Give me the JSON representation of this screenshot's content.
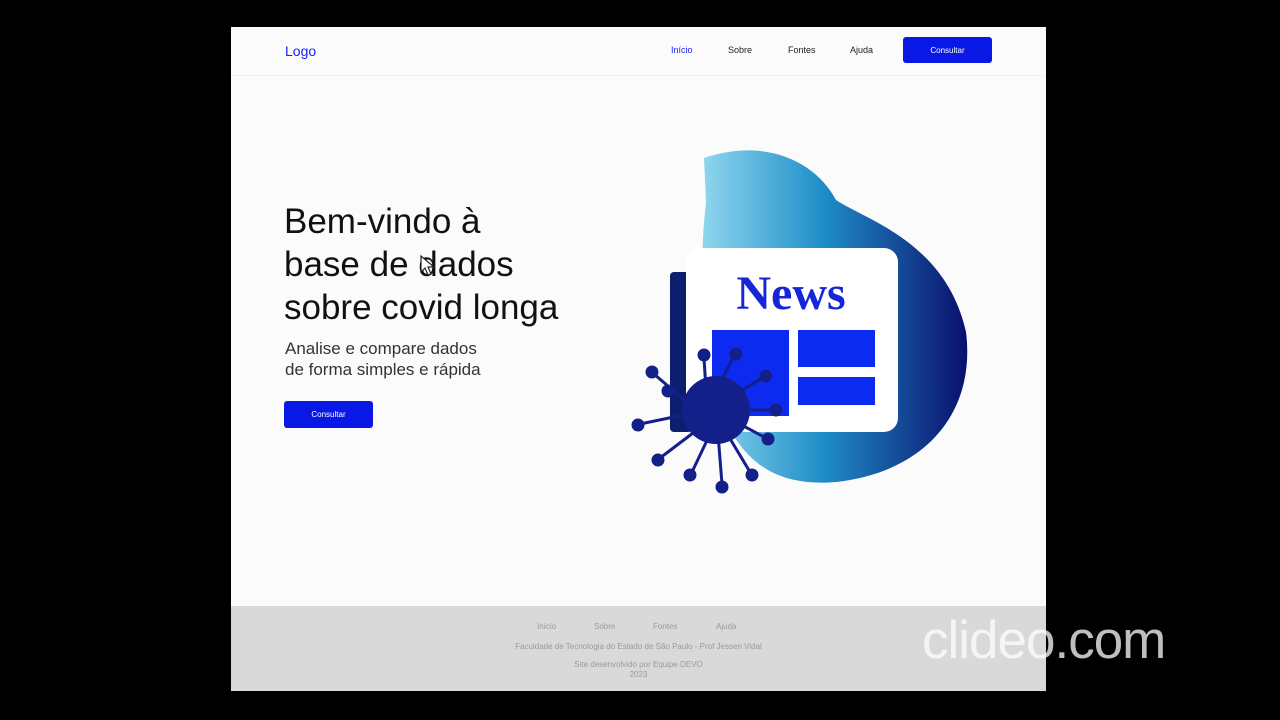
{
  "header": {
    "logo": "Logo",
    "nav": [
      "Início",
      "Sobre",
      "Fontes",
      "Ajuda"
    ],
    "cta": "Consultar"
  },
  "hero": {
    "title_lines": [
      "Bem-vindo à",
      "base de dados",
      "sobre covid longa"
    ],
    "subtitle_lines": [
      "Analise e compare dados",
      "de forma simples e rápida"
    ],
    "cta": "Consultar",
    "illustration_text": "News"
  },
  "footer": {
    "nav": [
      "Início",
      "Sobre",
      "Fontes",
      "Ajuda"
    ],
    "credits": "Faculdade de Tecnologia do Estado de São Paulo - Prof Jessen Vidal",
    "developed_by": "Site desenvolvido por Equipe DEVO",
    "year": "2023"
  },
  "watermark": "clideo.com",
  "colors": {
    "accent": "#0a18e6",
    "page_bg": "#fbfbfb",
    "footer_bg": "#d9d9d9",
    "virus": "#14208a"
  }
}
